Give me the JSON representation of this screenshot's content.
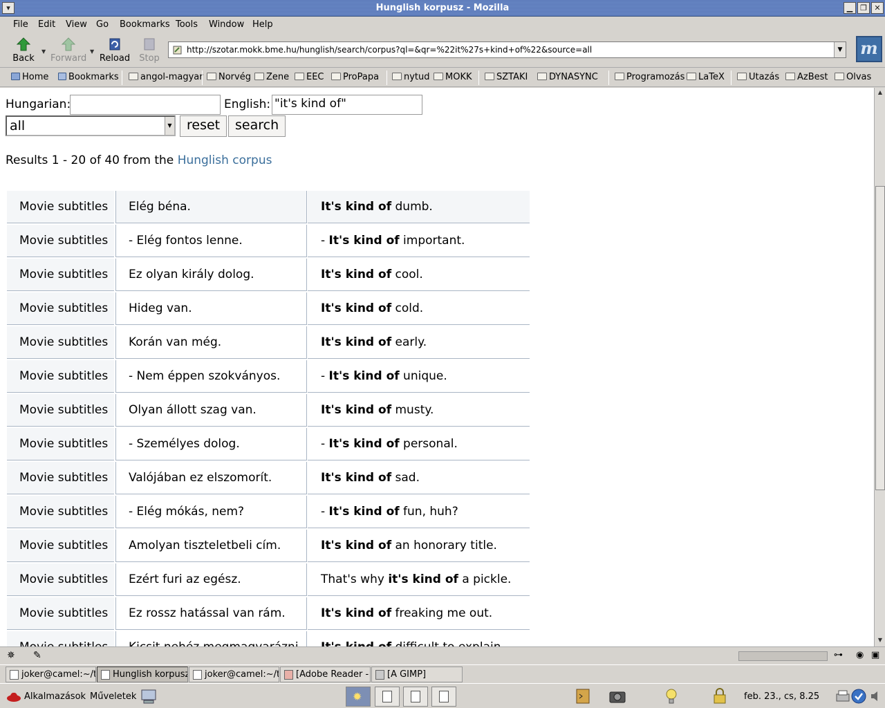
{
  "window": {
    "title": "Hunglish korpusz - Mozilla"
  },
  "menu": [
    "File",
    "Edit",
    "View",
    "Go",
    "Bookmarks",
    "Tools",
    "Window",
    "Help"
  ],
  "toolbar": {
    "back": "Back",
    "forward": "Forward",
    "reload": "Reload",
    "stop": "Stop",
    "url": "http://szotar.mokk.bme.hu/hunglish/search/corpus?ql=&qr=%22it%27s+kind+of%22&source=all"
  },
  "bookmarks": [
    "Home",
    "Bookmarks",
    "angol-magyar",
    "Norvég",
    "Zene",
    "EEC",
    "ProPapa",
    "nytud",
    "MOKK",
    "SZTAKI",
    "DYNASYNC",
    "Programozás",
    "LaTeX",
    "Utazás",
    "AzBest",
    "Olvas"
  ],
  "form": {
    "hungarian_label": "Hungarian:",
    "hungarian_value": "",
    "english_label": "English:",
    "english_value": "\"it's kind of\"",
    "source_value": "all",
    "reset_label": "reset",
    "search_label": "search"
  },
  "results": {
    "prefix": "Results 1 - 20 of 40 from the ",
    "link": "Hunglish corpus"
  },
  "rows": [
    {
      "source": "Movie subtitles",
      "hu": "Elég béna.",
      "en_pre": "",
      "en_bold": "It's kind of",
      "en_post": " dumb."
    },
    {
      "source": "Movie subtitles",
      "hu": "- Elég fontos lenne.",
      "en_pre": "- ",
      "en_bold": "It's kind of",
      "en_post": " important."
    },
    {
      "source": "Movie subtitles",
      "hu": "Ez olyan király dolog.",
      "en_pre": "",
      "en_bold": "It's kind of",
      "en_post": " cool."
    },
    {
      "source": "Movie subtitles",
      "hu": "Hideg van.",
      "en_pre": "",
      "en_bold": "It's kind of",
      "en_post": " cold."
    },
    {
      "source": "Movie subtitles",
      "hu": "Korán van még.",
      "en_pre": "",
      "en_bold": "It's kind of",
      "en_post": " early."
    },
    {
      "source": "Movie subtitles",
      "hu": "- Nem éppen szokványos.",
      "en_pre": "- ",
      "en_bold": "It's kind of",
      "en_post": " unique."
    },
    {
      "source": "Movie subtitles",
      "hu": "Olyan állott szag van.",
      "en_pre": "",
      "en_bold": "It's kind of",
      "en_post": " musty."
    },
    {
      "source": "Movie subtitles",
      "hu": "- Személyes dolog.",
      "en_pre": "- ",
      "en_bold": "It's kind of",
      "en_post": " personal."
    },
    {
      "source": "Movie subtitles",
      "hu": "Valójában ez elszomorít.",
      "en_pre": "",
      "en_bold": "It's kind of",
      "en_post": " sad."
    },
    {
      "source": "Movie subtitles",
      "hu": "- Elég mókás, nem?",
      "en_pre": "- ",
      "en_bold": "It's kind of",
      "en_post": " fun, huh?"
    },
    {
      "source": "Movie subtitles",
      "hu": "Amolyan tiszteletbeli cím.",
      "en_pre": "",
      "en_bold": "It's kind of",
      "en_post": " an honorary title."
    },
    {
      "source": "Movie subtitles",
      "hu": "Ezért furi az egész.",
      "en_pre": "That's why ",
      "en_bold": "it's kind of",
      "en_post": " a pickle."
    },
    {
      "source": "Movie subtitles",
      "hu": "Ez rossz hatással van rám.",
      "en_pre": "",
      "en_bold": "It's kind of",
      "en_post": " freaking me out."
    },
    {
      "source": "Movie subtitles",
      "hu": "Kicsit nehéz megmagyarázni.",
      "en_pre": "",
      "en_bold": "It's kind of",
      "en_post": " difficult to explain."
    }
  ],
  "taskbar": [
    "joker@camel:~/tm",
    "Hunglish korpusz",
    "joker@camel:~/tm",
    "[Adobe Reader - h",
    "[A GIMP]"
  ],
  "panel": {
    "applications": "Alkalmazások",
    "actions": "Műveletek",
    "clock": "feb. 23., cs,  8.25"
  }
}
